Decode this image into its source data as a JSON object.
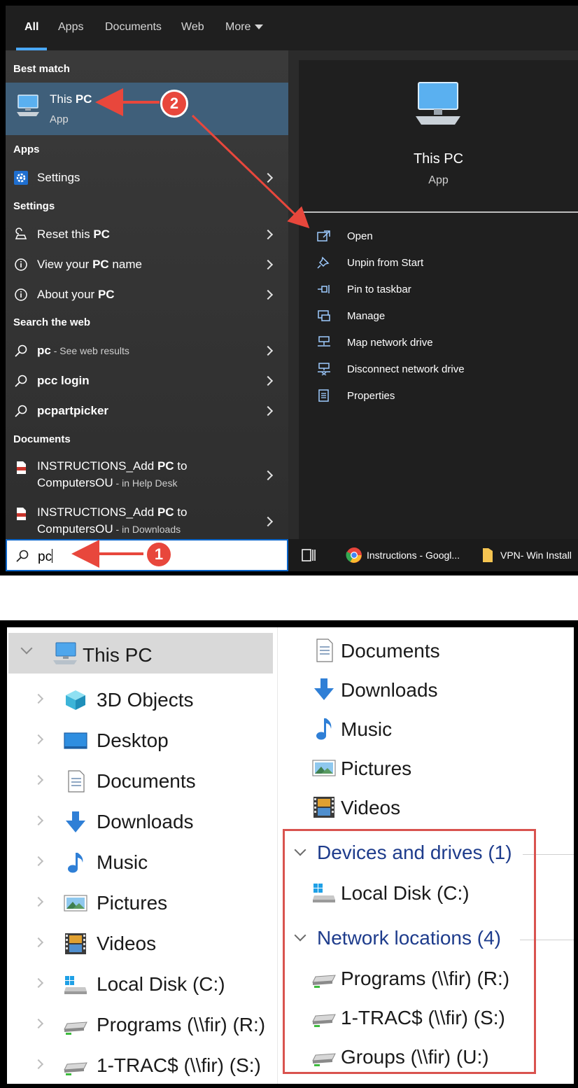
{
  "start_menu": {
    "tabs": [
      {
        "label": "All",
        "active": true
      },
      {
        "label": "Apps"
      },
      {
        "label": "Documents"
      },
      {
        "label": "Web"
      },
      {
        "label": "More"
      }
    ],
    "sections": {
      "best_match": "Best match",
      "apps": "Apps",
      "settings": "Settings",
      "search_web": "Search the web",
      "documents": "Documents"
    },
    "best_match": {
      "title_prefix": "This ",
      "title_bold": "PC",
      "type": "App"
    },
    "apps": [
      {
        "label": "Settings"
      }
    ],
    "settings": [
      {
        "prefix": "Reset this ",
        "bold": "PC",
        "suffix": ""
      },
      {
        "prefix": "View your ",
        "bold": "PC",
        "suffix": " name"
      },
      {
        "prefix": "About your ",
        "bold": "PC",
        "suffix": ""
      }
    ],
    "web": [
      {
        "prefix": "",
        "bold": "pc",
        "sub": " - See web results"
      },
      {
        "prefix": "",
        "bold": "pcc login",
        "sub": ""
      },
      {
        "prefix": "",
        "bold": "pcpartpicker",
        "sub": ""
      }
    ],
    "documents": [
      {
        "line1_prefix": "INSTRUCTIONS_Add ",
        "line1_bold": "PC",
        "line1_suffix": " to",
        "line2": "ComputersOU",
        "line2_sub": " - in Help Desk"
      },
      {
        "line1_prefix": "INSTRUCTIONS_Add ",
        "line1_bold": "PC",
        "line1_suffix": " to",
        "line2": "ComputersOU",
        "line2_sub": " - in Downloads"
      }
    ],
    "search": {
      "query": "pc"
    },
    "detail": {
      "title": "This PC",
      "type": "App",
      "actions": [
        {
          "label": "Open",
          "icon": "open-icon"
        },
        {
          "label": "Unpin from Start",
          "icon": "unpin-icon"
        },
        {
          "label": "Pin to taskbar",
          "icon": "pin-icon"
        },
        {
          "label": "Manage",
          "icon": "manage-icon"
        },
        {
          "label": "Map network drive",
          "icon": "map-drive-icon"
        },
        {
          "label": "Disconnect network drive",
          "icon": "disconnect-drive-icon"
        },
        {
          "label": "Properties",
          "icon": "properties-icon"
        }
      ]
    },
    "taskbar": [
      {
        "label": "Instructions - Googl...",
        "icon": "chrome-icon"
      },
      {
        "label": "VPN- Win Install",
        "icon": "folder-icon"
      }
    ]
  },
  "annotations": {
    "badge1": "1",
    "badge2": "2",
    "color": "#e8473c"
  },
  "explorer": {
    "nav": {
      "root": "This PC",
      "items": [
        {
          "label": "3D Objects",
          "icon": "3d-objects-icon"
        },
        {
          "label": "Desktop",
          "icon": "desktop-icon"
        },
        {
          "label": "Documents",
          "icon": "documents-icon"
        },
        {
          "label": "Downloads",
          "icon": "downloads-icon"
        },
        {
          "label": "Music",
          "icon": "music-icon"
        },
        {
          "label": "Pictures",
          "icon": "pictures-icon"
        },
        {
          "label": "Videos",
          "icon": "videos-icon"
        },
        {
          "label": "Local Disk (C:)",
          "icon": "local-disk-icon"
        },
        {
          "label": "Programs (\\\\fir) (R:)",
          "icon": "network-drive-icon"
        },
        {
          "label": "1-TRAC$ (\\\\fir) (S:)",
          "icon": "network-drive-icon"
        }
      ]
    },
    "content": {
      "folders": [
        {
          "label": "Documents",
          "icon": "documents-icon"
        },
        {
          "label": "Downloads",
          "icon": "downloads-icon"
        },
        {
          "label": "Music",
          "icon": "music-icon"
        },
        {
          "label": "Pictures",
          "icon": "pictures-icon"
        },
        {
          "label": "Videos",
          "icon": "videos-icon"
        }
      ],
      "devices_header": "Devices and drives (1)",
      "devices": [
        {
          "label": "Local Disk (C:)",
          "icon": "local-disk-icon"
        }
      ],
      "network_header": "Network locations (4)",
      "network": [
        {
          "label": "Programs (\\\\fir) (R:)",
          "icon": "network-drive-icon"
        },
        {
          "label": "1-TRAC$ (\\\\fir) (S:)",
          "icon": "network-drive-icon"
        },
        {
          "label": "Groups (\\\\fir) (U:)",
          "icon": "network-drive-icon"
        }
      ]
    }
  }
}
